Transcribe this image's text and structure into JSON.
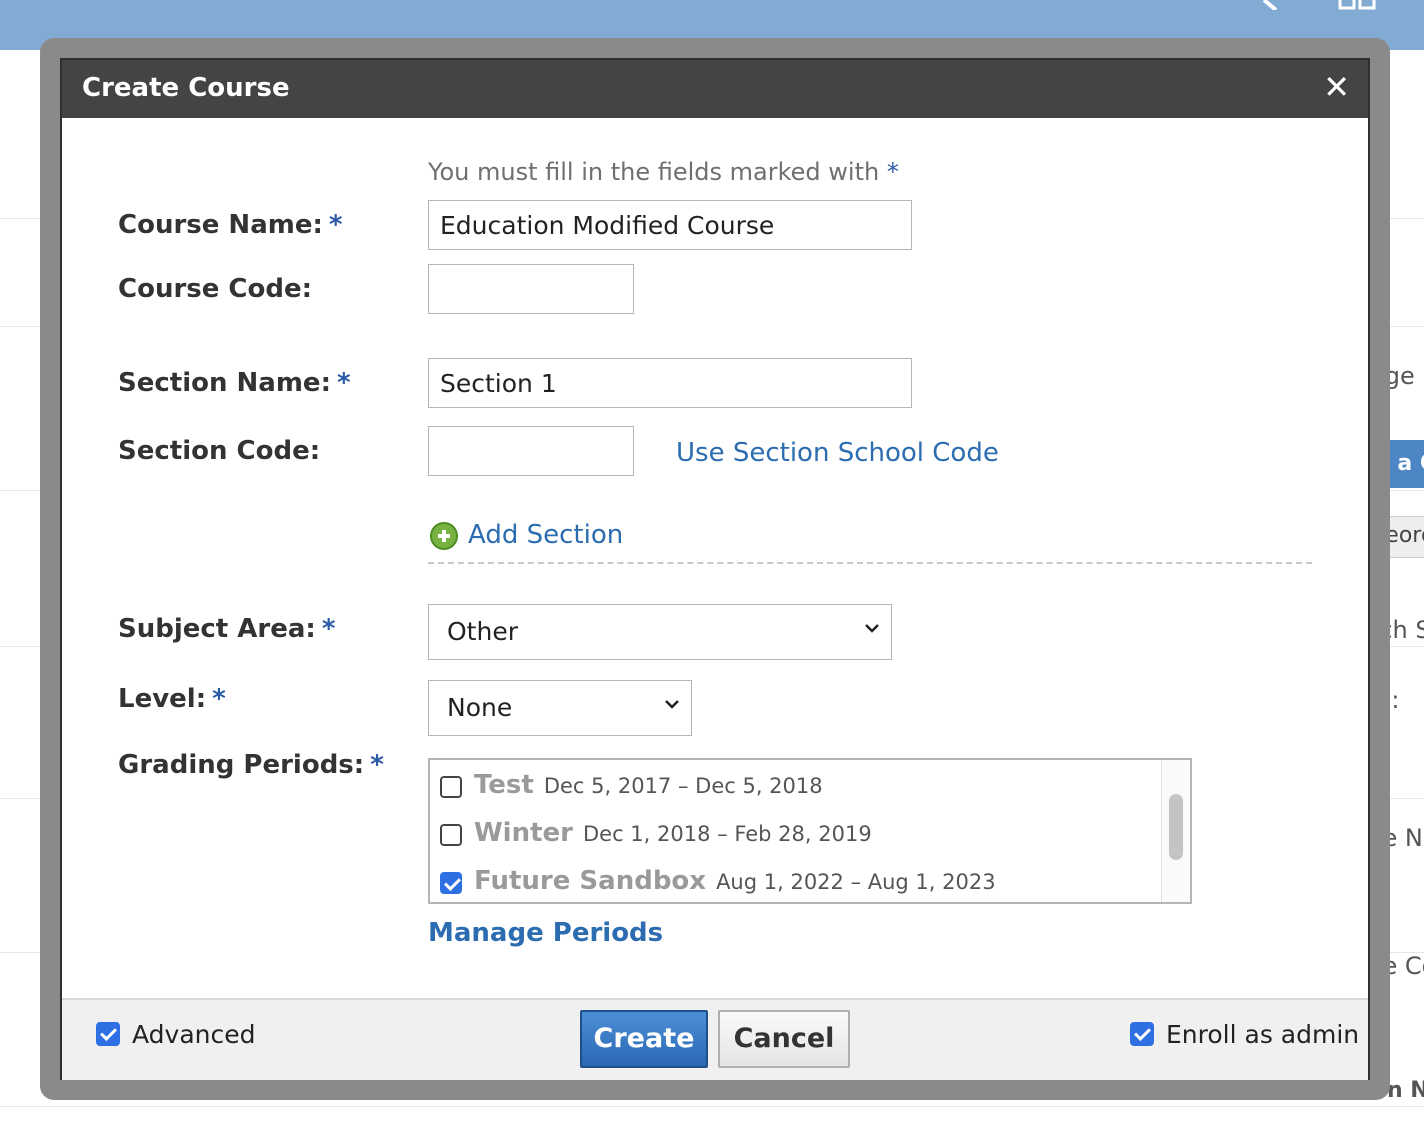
{
  "background": {
    "side_fragments": [
      "age",
      "n a Co",
      "Reord",
      "rch S",
      "ol:",
      "se Na",
      "se Co"
    ],
    "bottom_label": "Section Na"
  },
  "modal": {
    "title": "Create Course",
    "close_symbol": "✕",
    "required_note": "You must fill in the fields marked with",
    "required_marker": "*",
    "course_name": {
      "label": "Course Name:",
      "value": "Education Modified Course"
    },
    "course_code": {
      "label": "Course Code:",
      "value": ""
    },
    "section_name": {
      "label": "Section Name:",
      "value": "Section 1"
    },
    "section_code": {
      "label": "Section Code:",
      "value": ""
    },
    "use_section_school_code": "Use Section School Code",
    "add_section": "Add Section",
    "subject_area": {
      "label": "Subject Area:",
      "selected": "Other"
    },
    "level": {
      "label": "Level:",
      "selected": "None"
    },
    "grading_periods": {
      "label": "Grading Periods:",
      "items": [
        {
          "name": "Test",
          "dates": "Dec 5, 2017 – Dec 5, 2018",
          "checked": false
        },
        {
          "name": "Winter",
          "dates": "Dec 1, 2018 – Feb 28, 2019",
          "checked": false
        },
        {
          "name": "Future Sandbox",
          "dates": "Aug 1, 2022 – Aug 1, 2023",
          "checked": true
        }
      ]
    },
    "manage_periods": "Manage Periods",
    "footer": {
      "advanced_label": "Advanced",
      "advanced_checked": true,
      "create_label": "Create",
      "cancel_label": "Cancel",
      "enroll_label": "Enroll as admin",
      "enroll_checked": true
    }
  },
  "colors": {
    "topbar": "#81abd3",
    "header": "#444444",
    "link": "#2c6cb0",
    "required": "#2a5aa8",
    "checkbox": "#2f6fe4"
  }
}
